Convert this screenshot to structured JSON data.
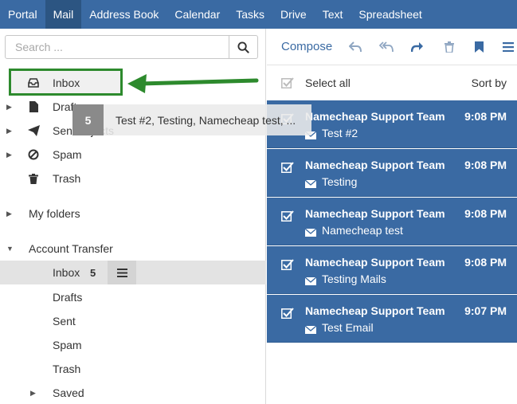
{
  "nav": {
    "items": [
      {
        "label": "Portal",
        "active": false
      },
      {
        "label": "Mail",
        "active": true
      },
      {
        "label": "Address Book",
        "active": false
      },
      {
        "label": "Calendar",
        "active": false
      },
      {
        "label": "Tasks",
        "active": false
      },
      {
        "label": "Drive",
        "active": false
      },
      {
        "label": "Text",
        "active": false
      },
      {
        "label": "Spreadsheet",
        "active": false
      }
    ]
  },
  "search": {
    "placeholder": "Search ...",
    "icon": "search-icon"
  },
  "folders": {
    "inbox": "Inbox",
    "drafts": "Drafts",
    "sent": "Sent objects",
    "spam": "Spam",
    "trash": "Trash"
  },
  "sections": {
    "my_folders": "My folders",
    "account_transfer": "Account Transfer"
  },
  "account_transfer": {
    "inbox": "Inbox",
    "inbox_count": "5",
    "drafts": "Drafts",
    "sent": "Sent",
    "spam": "Spam",
    "trash": "Trash",
    "saved": "Saved"
  },
  "drag": {
    "count": "5",
    "text": "Test #2, Testing, Namecheap test, ..."
  },
  "toolbar": {
    "compose": "Compose",
    "icons": [
      "reply-icon",
      "reply-all-icon",
      "forward-icon",
      "trash-icon",
      "bookmark-icon",
      "menu-icon"
    ]
  },
  "list": {
    "select_all": "Select all",
    "sort_by": "Sort by"
  },
  "messages": [
    {
      "sender": "Namecheap Support Team",
      "time": "9:08 PM",
      "subject": "Test #2"
    },
    {
      "sender": "Namecheap Support Team",
      "time": "9:08 PM",
      "subject": "Testing"
    },
    {
      "sender": "Namecheap Support Team",
      "time": "9:08 PM",
      "subject": "Namecheap test"
    },
    {
      "sender": "Namecheap Support Team",
      "time": "9:08 PM",
      "subject": "Testing Mails"
    },
    {
      "sender": "Namecheap Support Team",
      "time": "9:07 PM",
      "subject": "Test Email"
    }
  ],
  "colors": {
    "nav_bg": "#3a6aa3",
    "nav_active": "#2c5582",
    "selected_msg": "#3a6aa3",
    "highlight_green": "#2d8a2d"
  }
}
